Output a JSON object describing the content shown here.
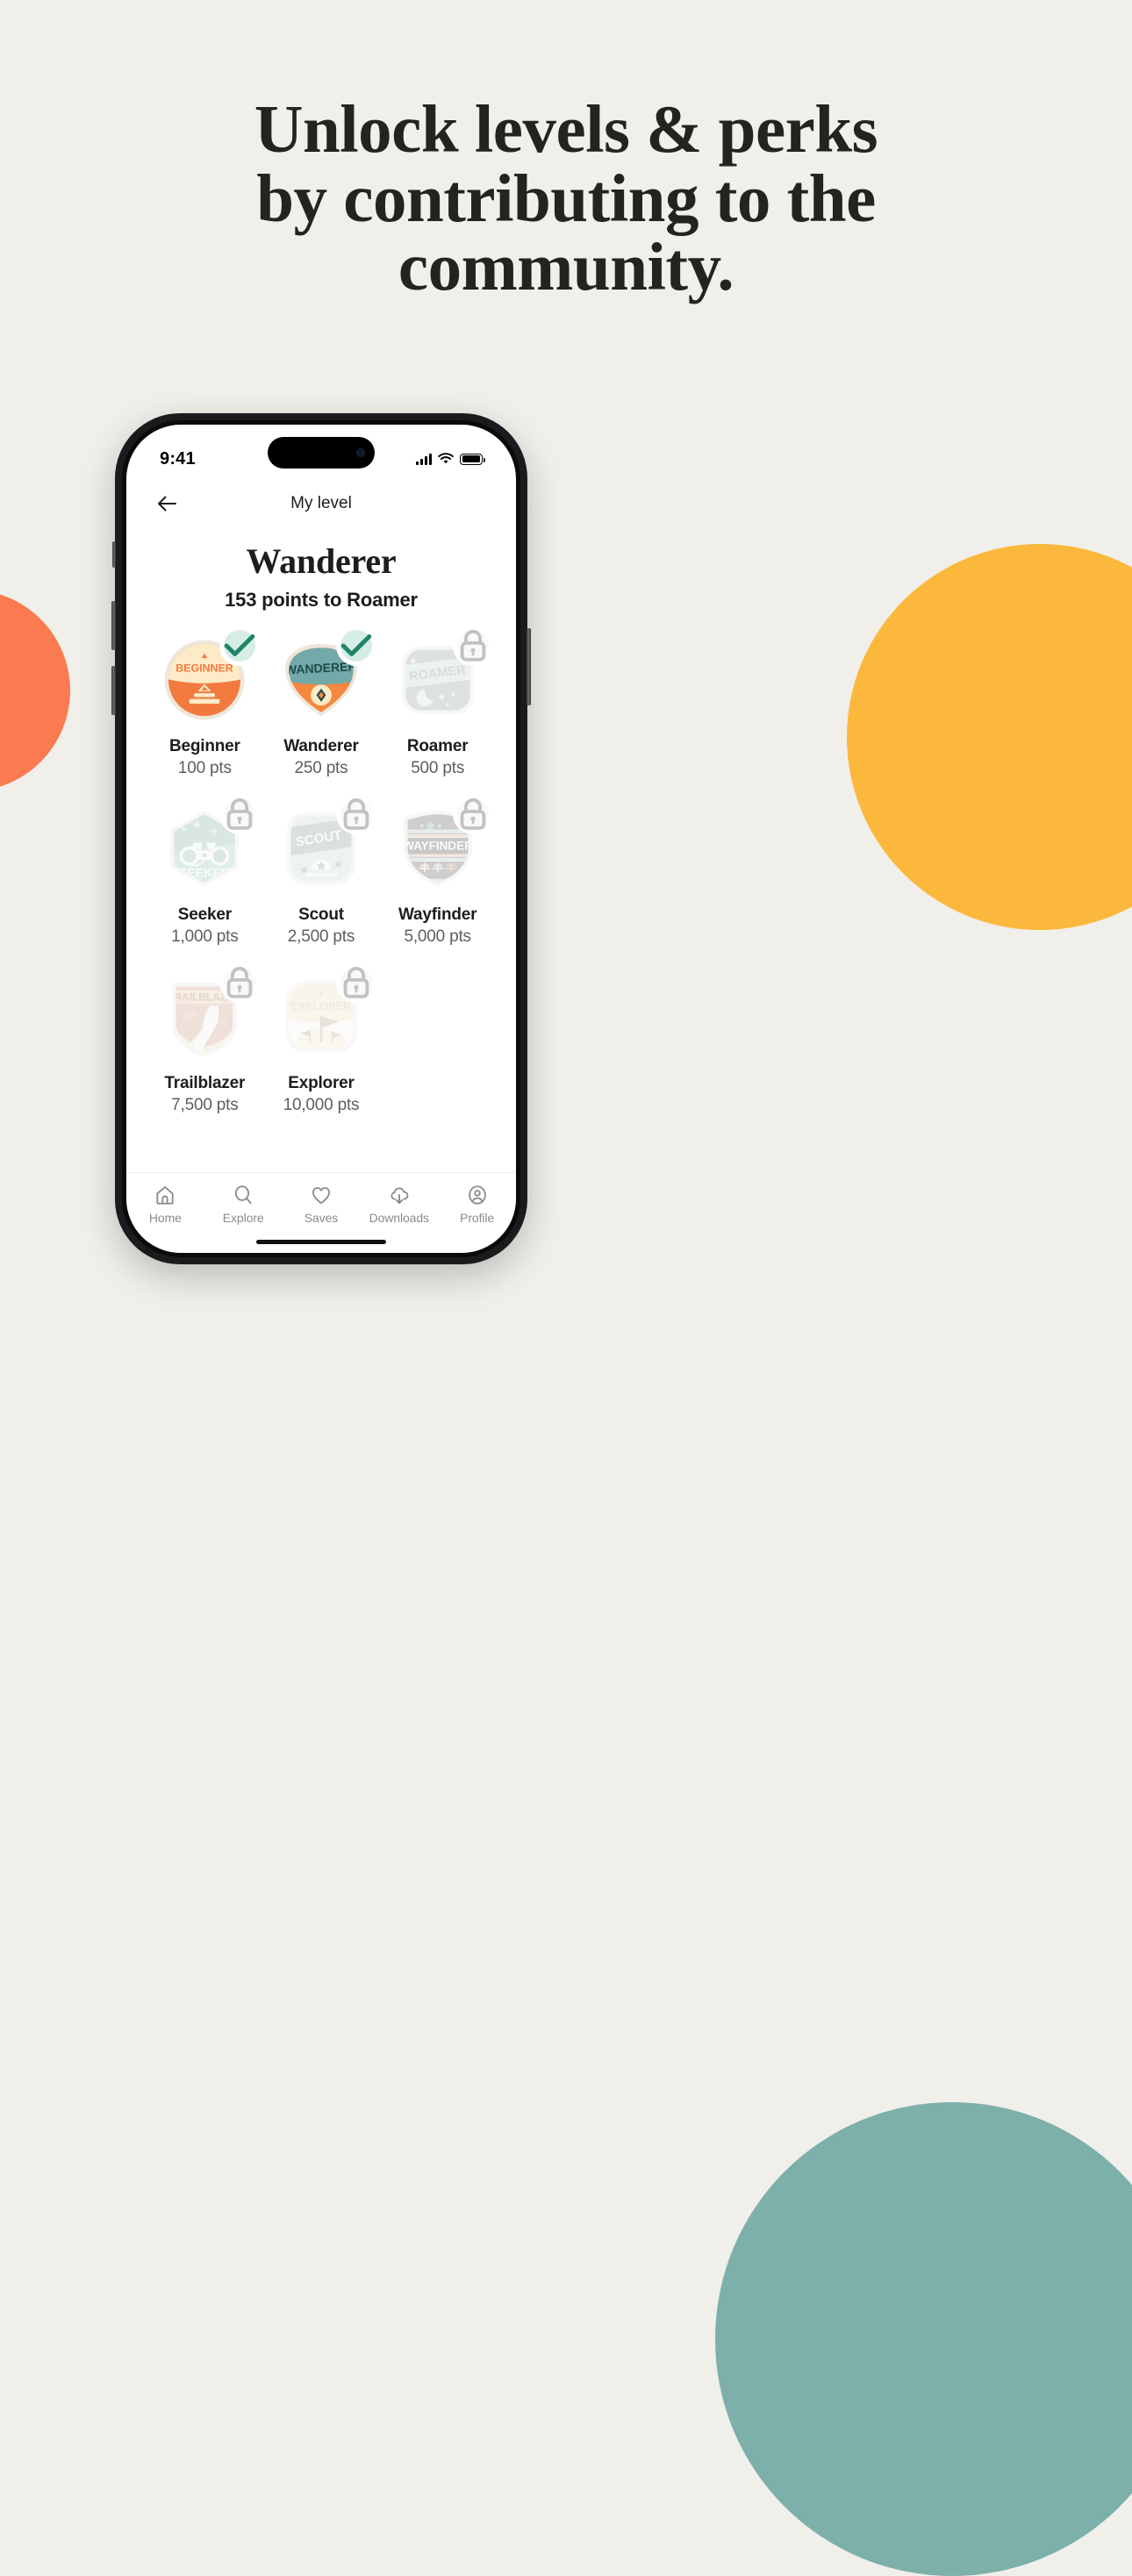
{
  "page": {
    "background_color": "#F0EFEA",
    "headline_lines": [
      "Unlock levels & perks",
      "by contributing to the",
      "community."
    ]
  },
  "decor": {
    "yellow": "#FCB83C",
    "orange": "#F97B4F",
    "teal": "#7DAFAB"
  },
  "status_bar": {
    "time": "9:41",
    "icons": [
      "cellular-signal-icon",
      "wifi-icon",
      "battery-icon"
    ]
  },
  "nav": {
    "back_icon": "arrow-left-icon",
    "title": "My level"
  },
  "level": {
    "name": "Wanderer",
    "progress_text": "153 points to Roamer"
  },
  "badges": [
    {
      "name": "Beginner",
      "points": "100 pts",
      "state": "earned",
      "chip_icon": "check-icon",
      "art": "beginner-badge-art"
    },
    {
      "name": "Wanderer",
      "points": "250 pts",
      "state": "earned",
      "chip_icon": "check-icon",
      "art": "wanderer-badge-art"
    },
    {
      "name": "Roamer",
      "points": "500 pts",
      "state": "locked",
      "chip_icon": "lock-icon",
      "art": "roamer-badge-art"
    },
    {
      "name": "Seeker",
      "points": "1,000 pts",
      "state": "locked",
      "chip_icon": "lock-icon",
      "art": "seeker-badge-art"
    },
    {
      "name": "Scout",
      "points": "2,500 pts",
      "state": "locked",
      "chip_icon": "lock-icon",
      "art": "scout-badge-art"
    },
    {
      "name": "Wayfinder",
      "points": "5,000 pts",
      "state": "locked",
      "chip_icon": "lock-icon",
      "art": "wayfinder-badge-art"
    },
    {
      "name": "Trailblazer",
      "points": "7,500 pts",
      "state": "locked",
      "chip_icon": "lock-icon",
      "art": "trailblazer-badge-art"
    },
    {
      "name": "Explorer",
      "points": "10,000 pts",
      "state": "locked",
      "chip_icon": "lock-icon",
      "art": "explorer-badge-art"
    }
  ],
  "badge_art_text": {
    "beginner": "BEGINNER",
    "wanderer": "WANDERER",
    "roamer": "ROAMER",
    "seeker": "SEEKER",
    "scout": "SCOUT",
    "wayfinder": "WAYFINDER",
    "trailblazer": "TRAILBLAZER",
    "explorer": "EXPLORER"
  },
  "tabs": [
    {
      "label": "Home",
      "icon": "home-icon",
      "active": false
    },
    {
      "label": "Explore",
      "icon": "search-icon",
      "active": false
    },
    {
      "label": "Saves",
      "icon": "heart-icon",
      "active": false
    },
    {
      "label": "Downloads",
      "icon": "cloud-download-icon",
      "active": false
    },
    {
      "label": "Profile",
      "icon": "user-circle-icon",
      "active": false
    }
  ]
}
